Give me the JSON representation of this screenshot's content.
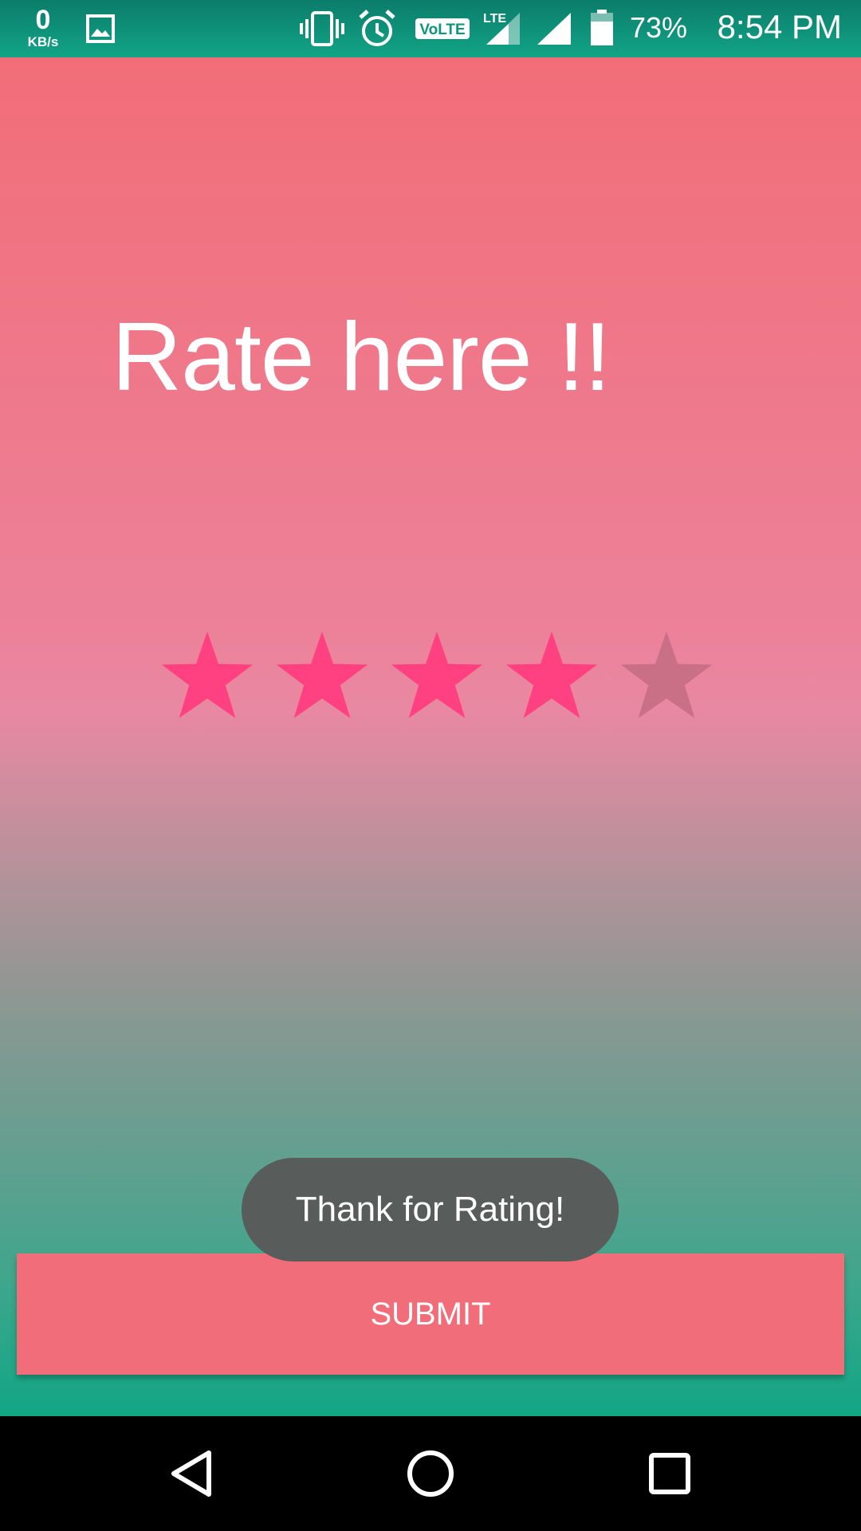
{
  "status_bar": {
    "net_speed_value": "0",
    "net_speed_unit": "KB/s",
    "battery_percent": "73%",
    "time": "8:54 PM",
    "icons": [
      "image-icon",
      "vibrate-icon",
      "alarm-icon",
      "volte-icon",
      "lte-signal-icon",
      "signal-icon",
      "battery-icon"
    ]
  },
  "app": {
    "title": "Rate here !!",
    "rating": {
      "value": 4,
      "max": 5,
      "filled_color": "#ff4081",
      "empty_color": "#c96f86"
    },
    "toast": "Thank for Rating!",
    "submit_label": "SUBMIT"
  },
  "nav_bar": {
    "icons": [
      "back-icon",
      "home-icon",
      "recents-icon"
    ]
  }
}
